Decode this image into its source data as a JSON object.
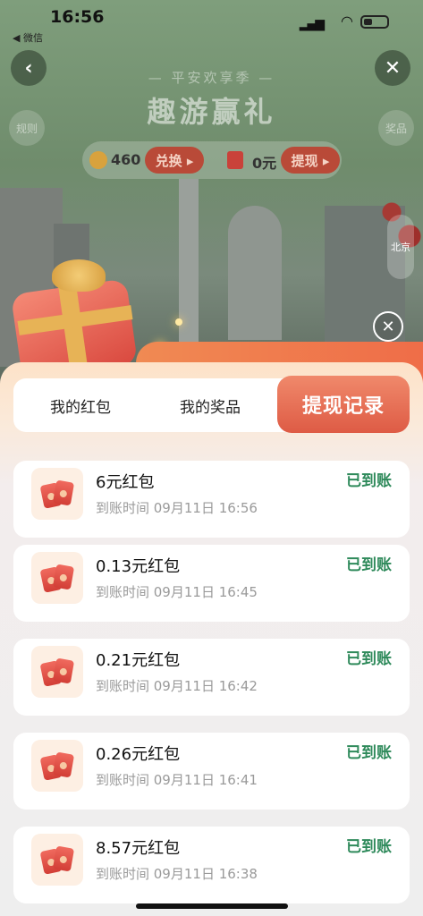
{
  "status_bar": {
    "time": "16:56",
    "back_app": "◀ 微信"
  },
  "header": {
    "subtitle": "— 平安欢享季 —",
    "title": "趣游赢礼",
    "rules": "规则",
    "prizes": "奖品"
  },
  "coins": {
    "points": "460",
    "exchange_label": "兑换 ▸",
    "cash": "0元",
    "withdraw_label": "提现 ▸"
  },
  "map": {
    "city": "北京"
  },
  "tabs": [
    {
      "label": "我的红包"
    },
    {
      "label": "我的奖品"
    },
    {
      "label": "提现记录"
    }
  ],
  "records": [
    {
      "name": "6元红包",
      "time": "到账时间   09月11日 16:56",
      "status": "已到账"
    },
    {
      "name": "0.13元红包",
      "time": "到账时间   09月11日 16:45",
      "status": "已到账"
    },
    {
      "name": "0.21元红包",
      "time": "到账时间   09月11日 16:42",
      "status": "已到账"
    },
    {
      "name": "0.26元红包",
      "time": "到账时间   09月11日 16:41",
      "status": "已到账"
    },
    {
      "name": "8.57元红包",
      "time": "到账时间   09月11日 16:38",
      "status": "已到账"
    }
  ],
  "colors": {
    "accent": "#de5b45",
    "success": "#2f8a5b"
  },
  "icons": {
    "back": "chevron-left-icon",
    "close": "close-icon",
    "record": "red-envelope-icon"
  }
}
